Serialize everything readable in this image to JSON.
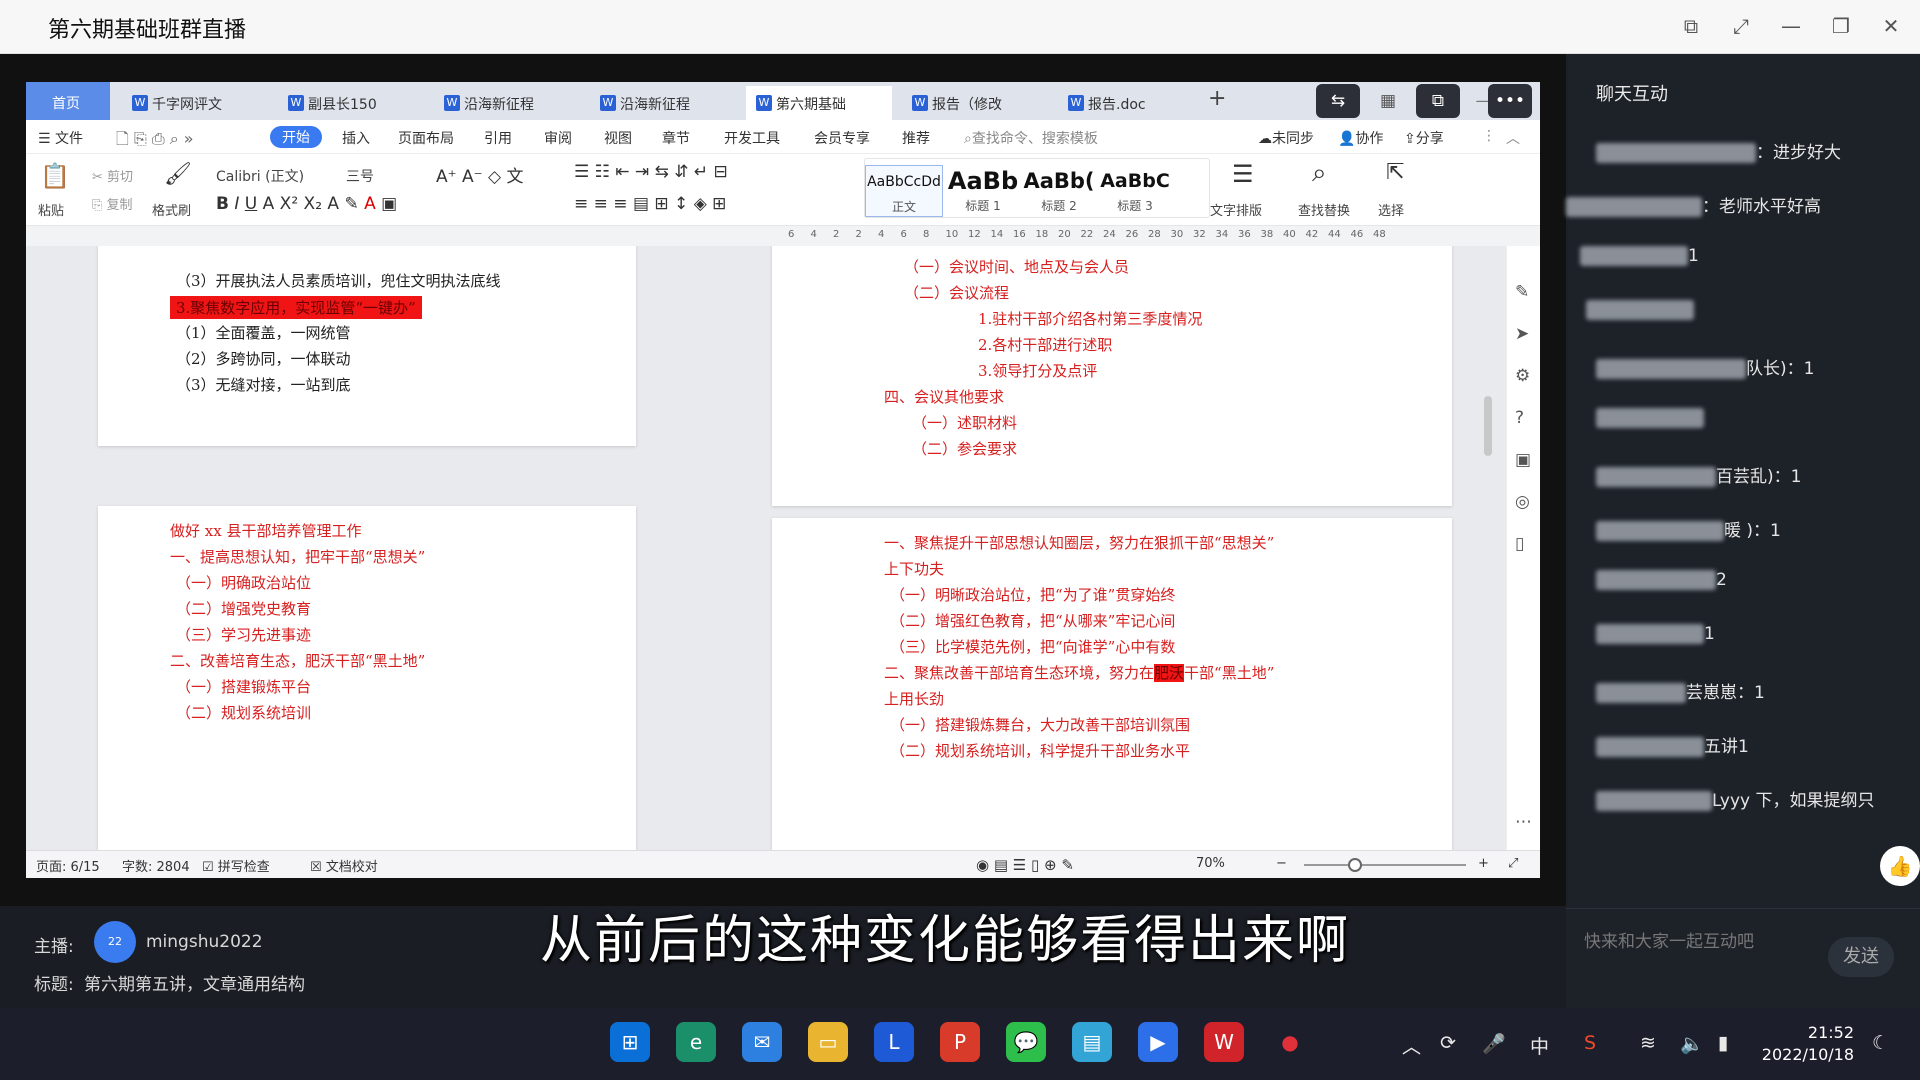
{
  "window": {
    "title": "第六期基础班群直播"
  },
  "wps": {
    "tabs": [
      {
        "label": "首页"
      },
      {
        "label": "千字网评文"
      },
      {
        "label": "副县长150"
      },
      {
        "label": "沿海新征程"
      },
      {
        "label": "沿海新征程"
      },
      {
        "label": "第六期基础"
      },
      {
        "label": "报告（修改"
      },
      {
        "label": "报告.doc"
      }
    ],
    "add_tab": "+",
    "menu": [
      "文件",
      "开始",
      "插入",
      "页面布局",
      "引用",
      "审阅",
      "视图",
      "章节",
      "开发工具",
      "会员专享",
      "推荐"
    ],
    "search_placeholder": "查找命令、搜索模板",
    "sync": "未同步",
    "collab": "协作",
    "share": "分享",
    "toolbar": {
      "paste": "粘贴",
      "cut": "剪切",
      "copy": "复制",
      "format_painter": "格式刷",
      "font": "Calibri (正文)",
      "size": "三号",
      "styles": [
        {
          "preview": "AaBbCcDd",
          "name": "正文"
        },
        {
          "preview": "AaBb",
          "name": "标题 1"
        },
        {
          "preview": "AaBb(",
          "name": "标题 2"
        },
        {
          "preview": "AaBbC",
          "name": "标题 3"
        }
      ],
      "text_layout": "文字排版",
      "find_replace": "查找替换",
      "select": "选择"
    },
    "ruler": [
      "6",
      "4",
      "2",
      "2",
      "4",
      "6",
      "8",
      "10",
      "12",
      "14",
      "16",
      "18",
      "20",
      "22",
      "24",
      "26",
      "28",
      "30",
      "32",
      "34",
      "36",
      "38",
      "40",
      "42",
      "44",
      "46",
      "48"
    ],
    "doc": {
      "page1_top": [
        "（3）开展执法人员素质培训，兜住文明执法底线",
        "3.聚焦数字应用，实现监管“一键办”",
        "（1）全面覆盖，一网统管",
        "（2）多跨协同，一体联动",
        "（3）无缝对接，一站到底"
      ],
      "page1_bottom": [
        "做好 xx 县干部培养管理工作",
        "一、提高思想认知，把牢干部“思想关”",
        "（一）明确政治站位",
        "（二）增强党史教育",
        "（三）学习先进事迹",
        "二、改善培育生态，肥沃干部“黑土地”",
        "（一）搭建锻炼平台",
        "（二）规划系统培训"
      ],
      "page2_top": [
        "（一）会议时间、地点及与会人员",
        "（二）会议流程",
        "1.驻村干部介绍各村第三季度情况",
        "2.各村干部进行述职",
        "3.领导打分及点评",
        "四、会议其他要求",
        "（一）述职材料",
        "（二）参会要求"
      ],
      "page2_bottom": [
        "一、聚焦提升干部思想认知圈层，努力在狠抓干部“思想关”",
        "上下功夫",
        "（一）明晰政治站位，把“为了谁”贯穿始终",
        "（二）增强红色教育，把“从哪来”牢记心间",
        "（三）比学模范先例，把“向谁学”心中有数",
        "二、聚焦改善干部培育生态环境，努力在",
        "肥沃",
        "干部“黑土地”",
        "上用长劲",
        "（一）搭建锻炼舞台，大力改善干部培训氛围",
        "（二）规划系统培训，科学提升干部业务水平"
      ]
    },
    "status": {
      "page": "页面: 6/15",
      "words": "字数: 2804",
      "spell": "拼写检查",
      "proof": "文档校对",
      "zoom": "70%"
    }
  },
  "chat": {
    "title": "聊天互动",
    "messages": [
      {
        "text": "：进步好大"
      },
      {
        "text": "：老师水平好高"
      },
      {
        "text": "1"
      },
      {
        "text": ""
      },
      {
        "text": "队长)：1"
      },
      {
        "text": ""
      },
      {
        "text": "百芸乱)：1"
      },
      {
        "text": "暖 )：1"
      },
      {
        "text": "2"
      },
      {
        "text": "1"
      },
      {
        "text": "芸崽崽：1"
      },
      {
        "text": "五讲1"
      },
      {
        "text": "Lyyy 下，如果提纲只"
      }
    ],
    "input_placeholder": "快来和大家一起互动吧",
    "send": "发送"
  },
  "stream": {
    "host_label": "主播:",
    "host_avatar": "22",
    "host": "mingshu2022",
    "title_label": "标题:",
    "title": "第六期第五讲，文章通用结构",
    "subtitle": "从前后的这种变化能够看得出来啊"
  },
  "taskbar": {
    "ime": "中",
    "time": "21:52",
    "date": "2022/10/18"
  }
}
